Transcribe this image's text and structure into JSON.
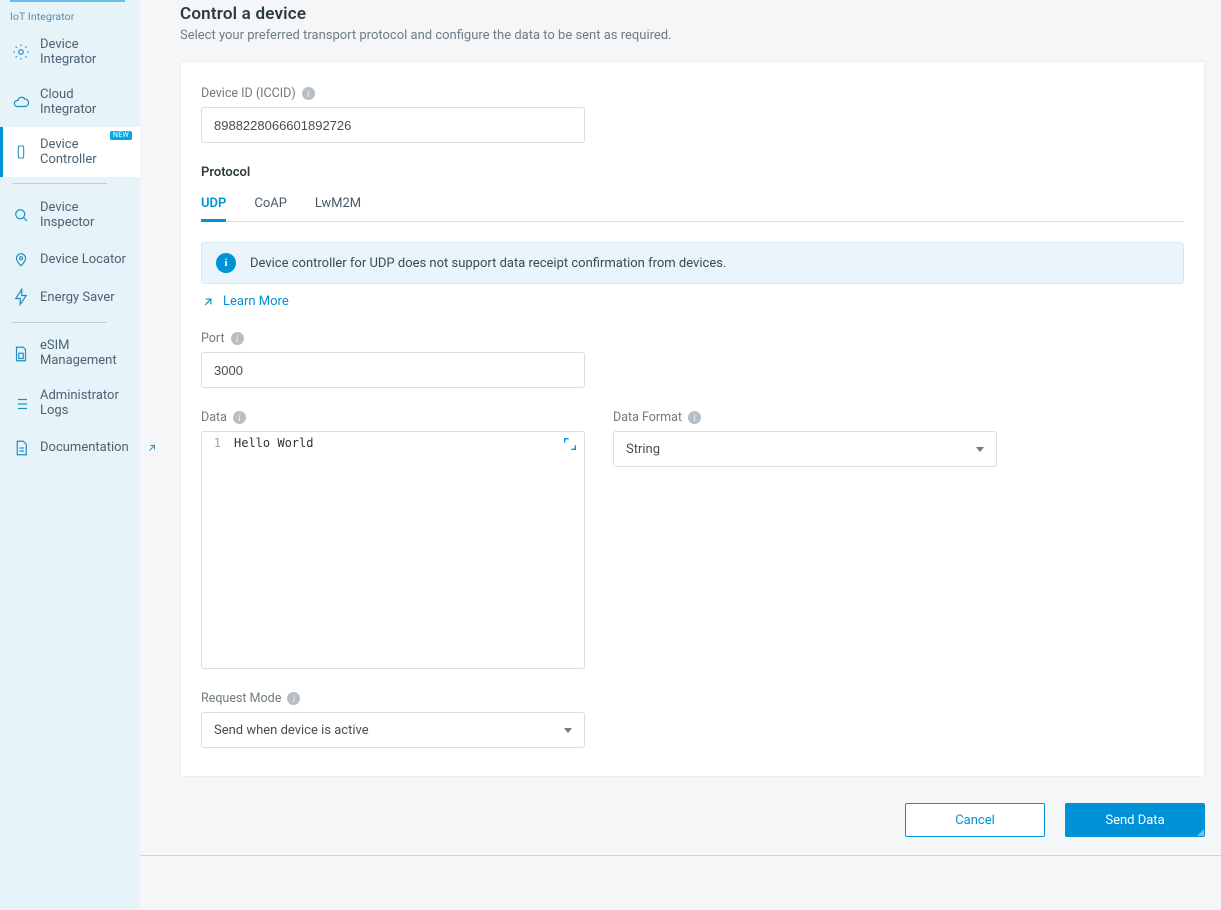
{
  "sidebar": {
    "section_label": "IoT Integrator",
    "new_badge": "NEW",
    "items": [
      {
        "label": "Device Integrator"
      },
      {
        "label": "Cloud Integrator"
      },
      {
        "label": "Device Controller"
      },
      {
        "label": "Device Inspector"
      },
      {
        "label": "Device Locator"
      },
      {
        "label": "Energy Saver"
      },
      {
        "label": "eSIM Management"
      },
      {
        "label": "Administrator Logs"
      },
      {
        "label": "Documentation"
      }
    ]
  },
  "page": {
    "title": "Control a device",
    "subtitle": "Select your preferred transport protocol and configure the data to be sent as required."
  },
  "form": {
    "device_id_label": "Device ID (ICCID)",
    "device_id_value": "8988228066601892726",
    "protocol_label": "Protocol",
    "tabs": {
      "udp": "UDP",
      "coap": "CoAP",
      "lwm2m": "LwM2M"
    },
    "info_message": "Device controller for UDP does not support data receipt confirmation from devices.",
    "learn_more": "Learn More",
    "port_label": "Port",
    "port_value": "3000",
    "data_label": "Data",
    "data_line_number": "1",
    "data_value": "Hello World",
    "data_format_label": "Data Format",
    "data_format_value": "String",
    "request_mode_label": "Request Mode",
    "request_mode_value": "Send when device is active"
  },
  "footer": {
    "cancel": "Cancel",
    "send": "Send Data"
  }
}
